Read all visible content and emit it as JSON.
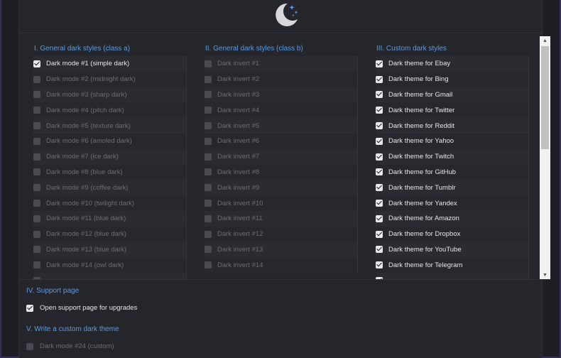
{
  "columns": [
    {
      "title": "I. General dark styles (class a)",
      "items": [
        {
          "label": "Dark mode #1 (simple dark)",
          "checked": true
        },
        {
          "label": "Dark mode #2 (midnight dark)",
          "checked": false
        },
        {
          "label": "Dark mode #3 (sharp dark)",
          "checked": false
        },
        {
          "label": "Dark mode #4 (pitch dark)",
          "checked": false
        },
        {
          "label": "Dark mode #5 (texture dark)",
          "checked": false
        },
        {
          "label": "Dark mode #6 (amoled dark)",
          "checked": false
        },
        {
          "label": "Dark mode #7 (ice dark)",
          "checked": false
        },
        {
          "label": "Dark mode #8 (blue dark)",
          "checked": false
        },
        {
          "label": "Dark mode #9 (coffee dark)",
          "checked": false
        },
        {
          "label": "Dark mode #10 (twilight dark)",
          "checked": false
        },
        {
          "label": "Dark mode #11 (blue dark)",
          "checked": false
        },
        {
          "label": "Dark mode #12 (blue dark)",
          "checked": false
        },
        {
          "label": "Dark mode #13 (blue dark)",
          "checked": false
        },
        {
          "label": "Dark mode #14 (owl dark)",
          "checked": false
        },
        {
          "label": "",
          "checked": false
        }
      ]
    },
    {
      "title": "II. General dark styles (class b)",
      "items": [
        {
          "label": "Dark invert #1",
          "checked": false
        },
        {
          "label": "Dark invert #2",
          "checked": false
        },
        {
          "label": "Dark invert #3",
          "checked": false
        },
        {
          "label": "Dark invert #4",
          "checked": false
        },
        {
          "label": "Dark invert #5",
          "checked": false
        },
        {
          "label": "Dark invert #6",
          "checked": false
        },
        {
          "label": "Dark invert #7",
          "checked": false
        },
        {
          "label": "Dark invert #8",
          "checked": false
        },
        {
          "label": "Dark invert #9",
          "checked": false
        },
        {
          "label": "Dark invert #10",
          "checked": false
        },
        {
          "label": "Dark invert #11",
          "checked": false
        },
        {
          "label": "Dark invert #12",
          "checked": false
        },
        {
          "label": "Dark invert #13",
          "checked": false
        },
        {
          "label": "Dark invert #14",
          "checked": false
        }
      ]
    },
    {
      "title": "III. Custom dark styles",
      "items": [
        {
          "label": "Dark theme for Ebay",
          "checked": true
        },
        {
          "label": "Dark theme for Bing",
          "checked": true
        },
        {
          "label": "Dark theme for Gmail",
          "checked": true
        },
        {
          "label": "Dark theme for Twitter",
          "checked": true
        },
        {
          "label": "Dark theme for Reddit",
          "checked": true
        },
        {
          "label": "Dark theme for Yahoo",
          "checked": true
        },
        {
          "label": "Dark theme for Twitch",
          "checked": true
        },
        {
          "label": "Dark theme for GitHub",
          "checked": true
        },
        {
          "label": "Dark theme for Tumblr",
          "checked": true
        },
        {
          "label": "Dark theme for Yandex",
          "checked": true
        },
        {
          "label": "Dark theme for Amazon",
          "checked": true
        },
        {
          "label": "Dark theme for Dropbox",
          "checked": true
        },
        {
          "label": "Dark theme for YouTube",
          "checked": true
        },
        {
          "label": "Dark theme for Telegram",
          "checked": true
        },
        {
          "label": "",
          "checked": true
        }
      ]
    }
  ],
  "support": {
    "title": "IV. Support page",
    "option_label": "Open support page for upgrades",
    "checked": true
  },
  "custom": {
    "title": "V. Write a custom dark theme",
    "option_label": "Dark mode #24 (custom)",
    "checked": false
  },
  "icons": {
    "logo": "moon-stars-icon",
    "scroll_up": "arrow-up-icon",
    "scroll_down": "arrow-down-icon"
  },
  "colors": {
    "accent": "#5b9be0",
    "panel": "#24262c",
    "background": "#1e1f24"
  }
}
